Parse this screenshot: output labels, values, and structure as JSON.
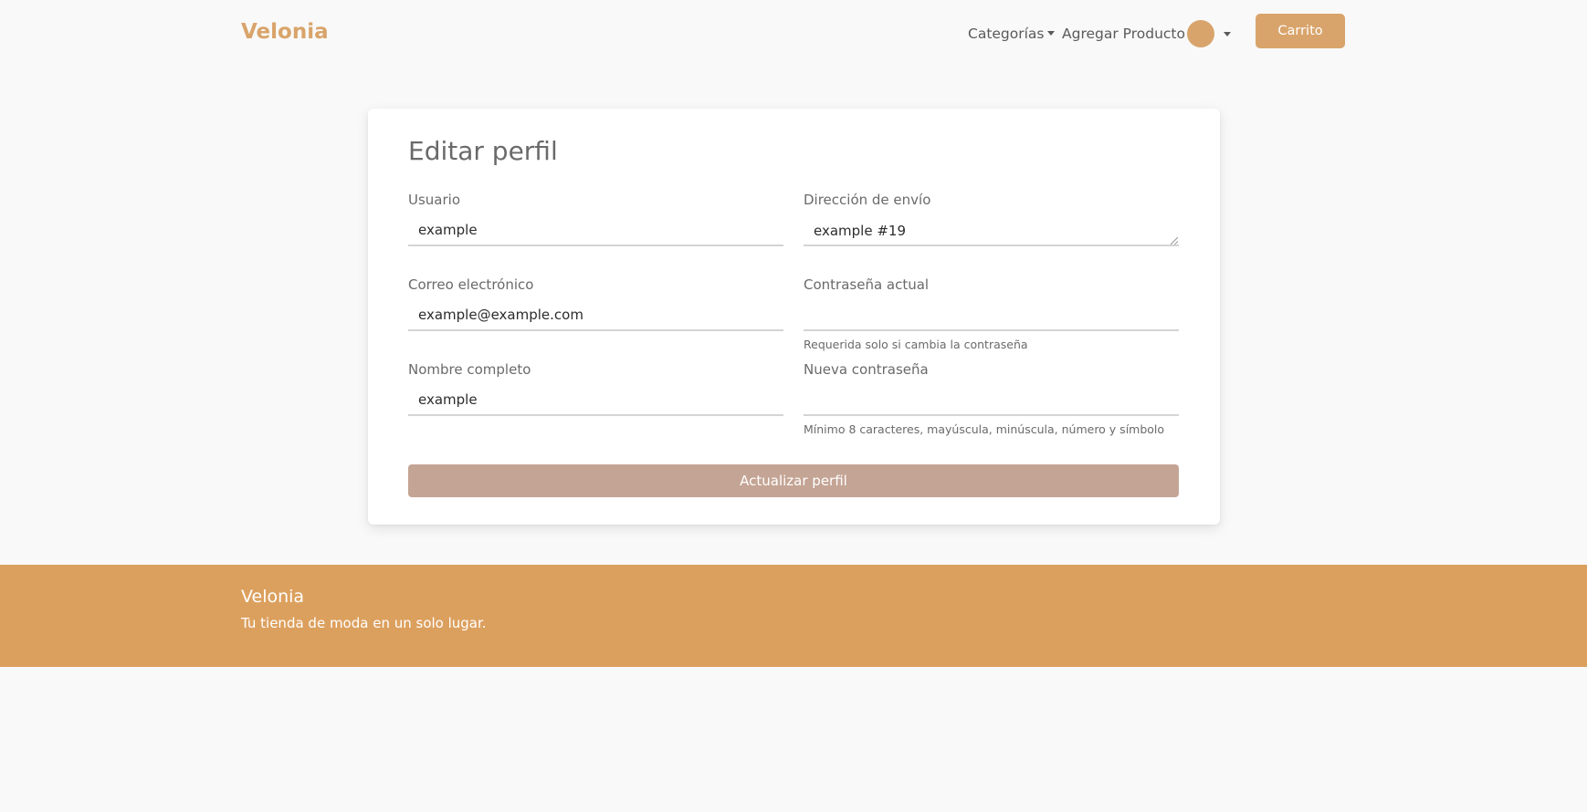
{
  "navbar": {
    "brand": "Velonia",
    "categories_label": "Categorías",
    "add_product_label": "Agregar Producto",
    "cart_label": "Carrito"
  },
  "form": {
    "title": "Editar perfil",
    "username": {
      "label": "Usuario",
      "value": "example"
    },
    "shipping_address": {
      "label": "Dirección de envío",
      "value": "example #19"
    },
    "email": {
      "label": "Correo electrónico",
      "value": "example@example.com"
    },
    "current_password": {
      "label": "Contraseña actual",
      "value": "",
      "hint": "Requerida solo si cambia la contraseña"
    },
    "full_name": {
      "label": "Nombre completo",
      "value": "example"
    },
    "new_password": {
      "label": "Nueva contraseña",
      "value": "",
      "hint": "Mínimo 8 caracteres, mayúscula, minúscula, número y símbolo"
    },
    "submit_label": "Actualizar perfil"
  },
  "footer": {
    "brand": "Velonia",
    "tagline": "Tu tienda de moda en un solo lugar."
  },
  "colors": {
    "accent": "#d9a46b",
    "footer_bg": "#dca05e",
    "submit_bg": "#c4a494",
    "page_bg": "#f9f9f9"
  }
}
